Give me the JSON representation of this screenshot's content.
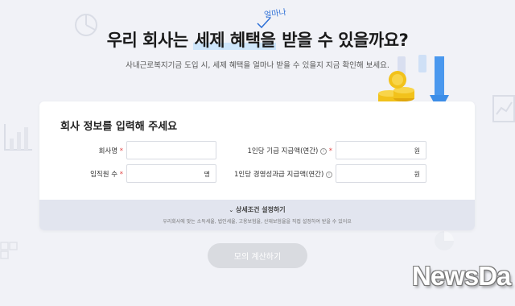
{
  "hero": {
    "title_before": "우리 회사는 ",
    "title_highlight": "세제 혜택을",
    "title_after": " 받을 수 있을까요?",
    "handwritten_note": "얼마나",
    "subtitle": "사내근로복지기금 도입 시, 세제 혜택을 얼마나 받을 수 있을지 지금 확인해 보세요."
  },
  "form": {
    "title": "회사 정보를 입력해 주세요",
    "fields": {
      "company_name": {
        "label": "회사명",
        "required_mark": "*",
        "value": "",
        "unit": ""
      },
      "employee_count": {
        "label": "임직원 수",
        "required_mark": "*",
        "value": "",
        "unit": "명"
      },
      "base_pay": {
        "label": "1인당 기급 지급액(연간)",
        "info_icon": "info-icon",
        "required_mark": "*",
        "value": "",
        "unit": "원"
      },
      "incentive_pay": {
        "label": "1인당 경영성과급 지급액(연간)",
        "info_icon": "info-icon",
        "value": "",
        "unit": "원"
      }
    },
    "detail_toggle": "상세조건 설정하기",
    "detail_note": "우리회사에 맞는 소득세율, 법인세율, 고용보험율, 산재보험율을 직접 설정하여 받을 수 있어요"
  },
  "actions": {
    "calculate": "모의 계산하기"
  },
  "watermark": "NewsDa",
  "colors": {
    "background": "#f1f2f7",
    "highlight": "#cfe6fb",
    "required": "#e04646",
    "button_disabled": "#d9dbe0",
    "coin": "#f2c21b",
    "arrow": "#3d8ee8"
  }
}
